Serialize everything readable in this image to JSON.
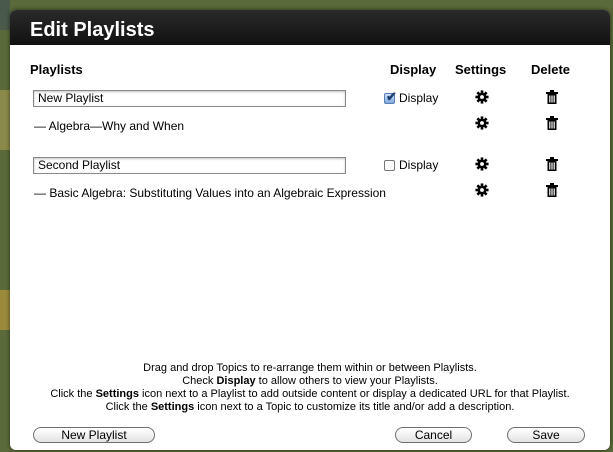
{
  "dialog": {
    "title": "Edit Playlists"
  },
  "headers": {
    "playlists": "Playlists",
    "display": "Display",
    "settings": "Settings",
    "delete": "Delete"
  },
  "playlists": [
    {
      "name": "New Playlist",
      "display_label": "Display",
      "display_checked": true,
      "topics": [
        "— Algebra—Why and When"
      ]
    },
    {
      "name": "Second Playlist",
      "display_label": "Display",
      "display_checked": false,
      "topics": [
        "— Basic Algebra: Substituting Values into an Algebraic Expression"
      ]
    }
  ],
  "help": {
    "line1": "Drag and drop Topics to re-arrange them within or between Playlists.",
    "line2_pre": "Check ",
    "line2_bold": "Display",
    "line2_post": " to allow others to view your Playlists.",
    "line3_pre": "Click the ",
    "line3_bold": "Settings",
    "line3_post": " icon next to a Playlist to add outside content or display a dedicated URL for that Playlist.",
    "line4_pre": "Click the ",
    "line4_bold": "Settings",
    "line4_post": " icon next to a Topic to customize its title and/or add a description."
  },
  "buttons": {
    "new_playlist": "New Playlist",
    "cancel": "Cancel",
    "save": "Save"
  },
  "icons": {
    "settings": "gear-icon",
    "delete": "trash-icon",
    "display": "checkbox"
  },
  "colors": {
    "titlebar": "#111111",
    "checkbox_checked": "#7fa9de"
  }
}
